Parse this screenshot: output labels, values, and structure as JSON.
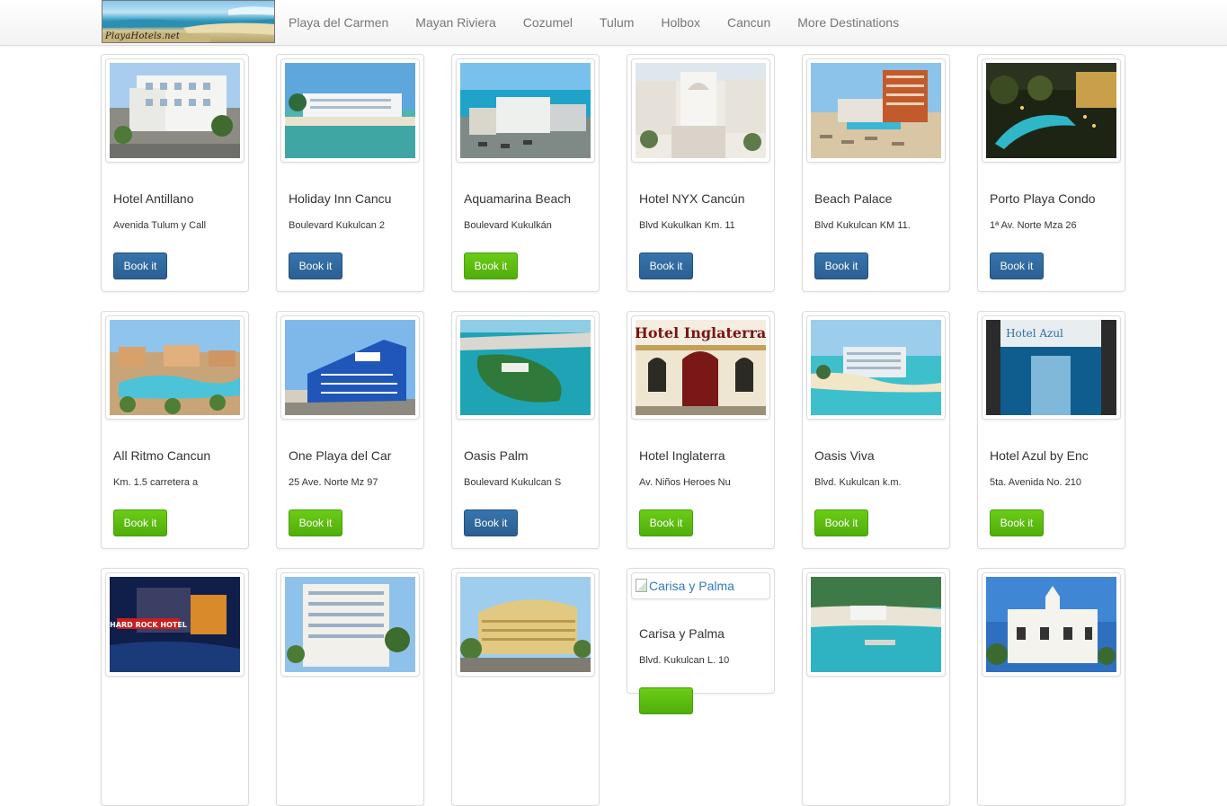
{
  "nav": {
    "logo_text": "PlayaHotels.net",
    "links": [
      "Playa del Carmen",
      "Mayan Riviera",
      "Cozumel",
      "Tulum",
      "Holbox",
      "Cancun",
      "More Destinations"
    ]
  },
  "hotels": [
    {
      "name": "Hotel Antillano",
      "address": "Avenida Tulum y Call",
      "button": "Book it",
      "button_color": "blue"
    },
    {
      "name": "Holiday Inn Cancu",
      "address": "Boulevard Kukulcan 2",
      "button": "Book it",
      "button_color": "blue"
    },
    {
      "name": "Aquamarina Beach",
      "address": "Boulevard Kukulkán",
      "button": "Book it",
      "button_color": "green"
    },
    {
      "name": "Hotel NYX Cancún",
      "address": "Blvd Kukulkan Km. 11",
      "button": "Book it",
      "button_color": "blue"
    },
    {
      "name": "Beach Palace",
      "address": "Blvd Kukulcan KM 11.",
      "button": "Book it",
      "button_color": "blue"
    },
    {
      "name": "Porto Playa Condo",
      "address": "1ª Av. Norte Mza 26",
      "button": "Book it",
      "button_color": "blue"
    },
    {
      "name": "All Ritmo Cancun",
      "address": "Km. 1.5 carretera a",
      "button": "Book it",
      "button_color": "green"
    },
    {
      "name": "One Playa del Car",
      "address": "25 Ave. Norte Mz 97",
      "button": "Book it",
      "button_color": "green"
    },
    {
      "name": "Oasis Palm",
      "address": "Boulevard Kukulcan S",
      "button": "Book it",
      "button_color": "blue"
    },
    {
      "name": "Hotel Inglaterra",
      "address": "Av. Niños Heroes Nu",
      "button": "Book it",
      "button_color": "green"
    },
    {
      "name": "Oasis Viva",
      "address": "Blvd. Kukulcan k.m.",
      "button": "Book it",
      "button_color": "green"
    },
    {
      "name": "Hotel Azul by Enc",
      "address": "5ta. Avenida No. 210",
      "button": "Book it",
      "button_color": "green"
    },
    {
      "name": "",
      "address": "",
      "button": "",
      "button_color": "blue"
    },
    {
      "name": "",
      "address": "",
      "button": "",
      "button_color": "blue"
    },
    {
      "name": "",
      "address": "",
      "button": "",
      "button_color": "blue"
    },
    {
      "name": "Carisa y Palma",
      "address": "Blvd. Kukulcan L. 10",
      "button": "",
      "button_color": "green",
      "broken_image_alt": "Carisa y Palma"
    },
    {
      "name": "",
      "address": "",
      "button": "",
      "button_color": "blue"
    },
    {
      "name": "",
      "address": "",
      "button": "",
      "button_color": "blue"
    }
  ],
  "photo_overlays": {
    "hotel_inglaterra_sign": "Hotel Inglaterra",
    "hotel_azul_sign": "Hotel Azul",
    "hard_rock_sign": "HARD ROCK HOTEL"
  },
  "colors": {
    "button_blue": "#2f6aa0",
    "button_green": "#5cb811",
    "link": "#337ab7",
    "nav_text": "#777777"
  }
}
